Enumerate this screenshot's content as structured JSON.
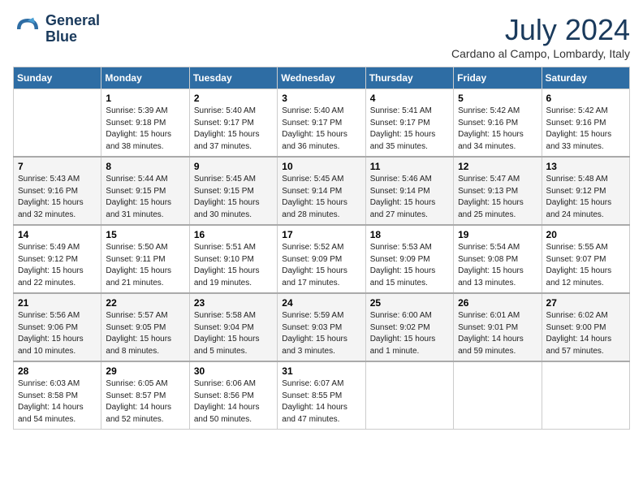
{
  "header": {
    "logo_line1": "General",
    "logo_line2": "Blue",
    "month_title": "July 2024",
    "subtitle": "Cardano al Campo, Lombardy, Italy"
  },
  "days_of_week": [
    "Sunday",
    "Monday",
    "Tuesday",
    "Wednesday",
    "Thursday",
    "Friday",
    "Saturday"
  ],
  "weeks": [
    [
      {
        "day": "",
        "info": ""
      },
      {
        "day": "1",
        "info": "Sunrise: 5:39 AM\nSunset: 9:18 PM\nDaylight: 15 hours\nand 38 minutes."
      },
      {
        "day": "2",
        "info": "Sunrise: 5:40 AM\nSunset: 9:17 PM\nDaylight: 15 hours\nand 37 minutes."
      },
      {
        "day": "3",
        "info": "Sunrise: 5:40 AM\nSunset: 9:17 PM\nDaylight: 15 hours\nand 36 minutes."
      },
      {
        "day": "4",
        "info": "Sunrise: 5:41 AM\nSunset: 9:17 PM\nDaylight: 15 hours\nand 35 minutes."
      },
      {
        "day": "5",
        "info": "Sunrise: 5:42 AM\nSunset: 9:16 PM\nDaylight: 15 hours\nand 34 minutes."
      },
      {
        "day": "6",
        "info": "Sunrise: 5:42 AM\nSunset: 9:16 PM\nDaylight: 15 hours\nand 33 minutes."
      }
    ],
    [
      {
        "day": "7",
        "info": "Sunrise: 5:43 AM\nSunset: 9:16 PM\nDaylight: 15 hours\nand 32 minutes."
      },
      {
        "day": "8",
        "info": "Sunrise: 5:44 AM\nSunset: 9:15 PM\nDaylight: 15 hours\nand 31 minutes."
      },
      {
        "day": "9",
        "info": "Sunrise: 5:45 AM\nSunset: 9:15 PM\nDaylight: 15 hours\nand 30 minutes."
      },
      {
        "day": "10",
        "info": "Sunrise: 5:45 AM\nSunset: 9:14 PM\nDaylight: 15 hours\nand 28 minutes."
      },
      {
        "day": "11",
        "info": "Sunrise: 5:46 AM\nSunset: 9:14 PM\nDaylight: 15 hours\nand 27 minutes."
      },
      {
        "day": "12",
        "info": "Sunrise: 5:47 AM\nSunset: 9:13 PM\nDaylight: 15 hours\nand 25 minutes."
      },
      {
        "day": "13",
        "info": "Sunrise: 5:48 AM\nSunset: 9:12 PM\nDaylight: 15 hours\nand 24 minutes."
      }
    ],
    [
      {
        "day": "14",
        "info": "Sunrise: 5:49 AM\nSunset: 9:12 PM\nDaylight: 15 hours\nand 22 minutes."
      },
      {
        "day": "15",
        "info": "Sunrise: 5:50 AM\nSunset: 9:11 PM\nDaylight: 15 hours\nand 21 minutes."
      },
      {
        "day": "16",
        "info": "Sunrise: 5:51 AM\nSunset: 9:10 PM\nDaylight: 15 hours\nand 19 minutes."
      },
      {
        "day": "17",
        "info": "Sunrise: 5:52 AM\nSunset: 9:09 PM\nDaylight: 15 hours\nand 17 minutes."
      },
      {
        "day": "18",
        "info": "Sunrise: 5:53 AM\nSunset: 9:09 PM\nDaylight: 15 hours\nand 15 minutes."
      },
      {
        "day": "19",
        "info": "Sunrise: 5:54 AM\nSunset: 9:08 PM\nDaylight: 15 hours\nand 13 minutes."
      },
      {
        "day": "20",
        "info": "Sunrise: 5:55 AM\nSunset: 9:07 PM\nDaylight: 15 hours\nand 12 minutes."
      }
    ],
    [
      {
        "day": "21",
        "info": "Sunrise: 5:56 AM\nSunset: 9:06 PM\nDaylight: 15 hours\nand 10 minutes."
      },
      {
        "day": "22",
        "info": "Sunrise: 5:57 AM\nSunset: 9:05 PM\nDaylight: 15 hours\nand 8 minutes."
      },
      {
        "day": "23",
        "info": "Sunrise: 5:58 AM\nSunset: 9:04 PM\nDaylight: 15 hours\nand 5 minutes."
      },
      {
        "day": "24",
        "info": "Sunrise: 5:59 AM\nSunset: 9:03 PM\nDaylight: 15 hours\nand 3 minutes."
      },
      {
        "day": "25",
        "info": "Sunrise: 6:00 AM\nSunset: 9:02 PM\nDaylight: 15 hours\nand 1 minute."
      },
      {
        "day": "26",
        "info": "Sunrise: 6:01 AM\nSunset: 9:01 PM\nDaylight: 14 hours\nand 59 minutes."
      },
      {
        "day": "27",
        "info": "Sunrise: 6:02 AM\nSunset: 9:00 PM\nDaylight: 14 hours\nand 57 minutes."
      }
    ],
    [
      {
        "day": "28",
        "info": "Sunrise: 6:03 AM\nSunset: 8:58 PM\nDaylight: 14 hours\nand 54 minutes."
      },
      {
        "day": "29",
        "info": "Sunrise: 6:05 AM\nSunset: 8:57 PM\nDaylight: 14 hours\nand 52 minutes."
      },
      {
        "day": "30",
        "info": "Sunrise: 6:06 AM\nSunset: 8:56 PM\nDaylight: 14 hours\nand 50 minutes."
      },
      {
        "day": "31",
        "info": "Sunrise: 6:07 AM\nSunset: 8:55 PM\nDaylight: 14 hours\nand 47 minutes."
      },
      {
        "day": "",
        "info": ""
      },
      {
        "day": "",
        "info": ""
      },
      {
        "day": "",
        "info": ""
      }
    ]
  ]
}
